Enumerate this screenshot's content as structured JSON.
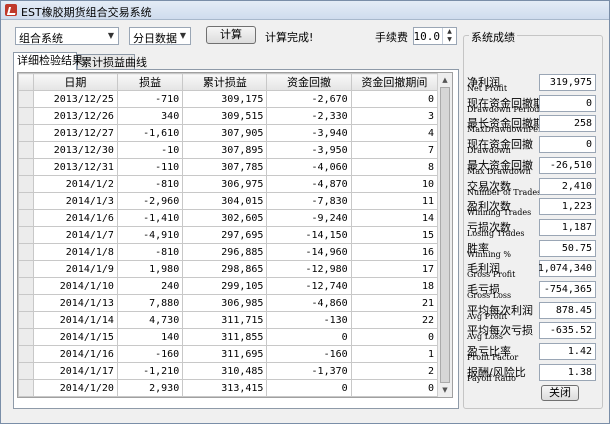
{
  "window": {
    "title": "EST橡胶期货组合交易系统"
  },
  "toolbar": {
    "system_select": "组合系统",
    "data_select": "分日数据",
    "compute_label": "计算",
    "status": "计算完成!",
    "fee_label": "手续费",
    "fee_value": "10.0"
  },
  "tabs": [
    "详细检验结果",
    "累计损益曲线"
  ],
  "table": {
    "columns": [
      "日期",
      "损益",
      "累计损益",
      "资金回撤",
      "资金回撤期间"
    ],
    "rows": [
      [
        "2013/12/25",
        "-710",
        "309,175",
        "-2,670",
        "0"
      ],
      [
        "2013/12/26",
        "340",
        "309,515",
        "-2,330",
        "3"
      ],
      [
        "2013/12/27",
        "-1,610",
        "307,905",
        "-3,940",
        "4"
      ],
      [
        "2013/12/30",
        "-10",
        "307,895",
        "-3,950",
        "7"
      ],
      [
        "2013/12/31",
        "-110",
        "307,785",
        "-4,060",
        "8"
      ],
      [
        "2014/1/2",
        "-810",
        "306,975",
        "-4,870",
        "10"
      ],
      [
        "2014/1/3",
        "-2,960",
        "304,015",
        "-7,830",
        "11"
      ],
      [
        "2014/1/6",
        "-1,410",
        "302,605",
        "-9,240",
        "14"
      ],
      [
        "2014/1/7",
        "-4,910",
        "297,695",
        "-14,150",
        "15"
      ],
      [
        "2014/1/8",
        "-810",
        "296,885",
        "-14,960",
        "16"
      ],
      [
        "2014/1/9",
        "1,980",
        "298,865",
        "-12,980",
        "17"
      ],
      [
        "2014/1/10",
        "240",
        "299,105",
        "-12,740",
        "18"
      ],
      [
        "2014/1/13",
        "7,880",
        "306,985",
        "-4,860",
        "21"
      ],
      [
        "2014/1/14",
        "4,730",
        "311,715",
        "-130",
        "22"
      ],
      [
        "2014/1/15",
        "140",
        "311,855",
        "0",
        "0"
      ],
      [
        "2014/1/16",
        "-160",
        "311,695",
        "-160",
        "1"
      ],
      [
        "2014/1/17",
        "-1,210",
        "310,485",
        "-1,370",
        "2"
      ],
      [
        "2014/1/20",
        "2,930",
        "313,415",
        "0",
        "0"
      ],
      [
        "2014/1/21",
        "3,930",
        "317,345",
        "0",
        "0"
      ],
      [
        "2014/1/22",
        "2,630",
        "319,975",
        "0",
        "0"
      ]
    ]
  },
  "stats": {
    "title": "系统成绩",
    "items": [
      {
        "cn": "净利润",
        "en": "Net Profit",
        "value": "319,975"
      },
      {
        "cn": "现在资金回撤期间",
        "en": "Drawdown Period",
        "value": "0"
      },
      {
        "cn": "最长资金回撤期间",
        "en": "MaxDrawdownPeriod",
        "value": "258"
      },
      {
        "cn": "现在资金回撤",
        "en": "Drawdown",
        "value": "0"
      },
      {
        "cn": "最大资金回撤",
        "en": "Max Drawdown",
        "value": "-26,510"
      },
      {
        "cn": "交易次数",
        "en": "Number of Trades",
        "value": "2,410"
      },
      {
        "cn": "盈利次数",
        "en": "Winning Trades",
        "value": "1,223"
      },
      {
        "cn": "亏损次数",
        "en": "Losing Trades",
        "value": "1,187"
      },
      {
        "cn": "胜率",
        "en": "Winning %",
        "value": "50.75"
      },
      {
        "cn": "毛利润",
        "en": "Gross Profit",
        "value": "1,074,340"
      },
      {
        "cn": "毛亏损",
        "en": "Gross Loss",
        "value": "-754,365"
      },
      {
        "cn": "平均每次利润",
        "en": "Avg Profit",
        "value": "878.45"
      },
      {
        "cn": "平均每次亏损",
        "en": "Avg Loss",
        "value": "-635.52"
      },
      {
        "cn": "盈亏比率",
        "en": "Profit Factor",
        "value": "1.42"
      },
      {
        "cn": "报酬/风险比",
        "en": "Payoff Ratio",
        "value": "1.38"
      }
    ],
    "close_label": "关闭"
  }
}
